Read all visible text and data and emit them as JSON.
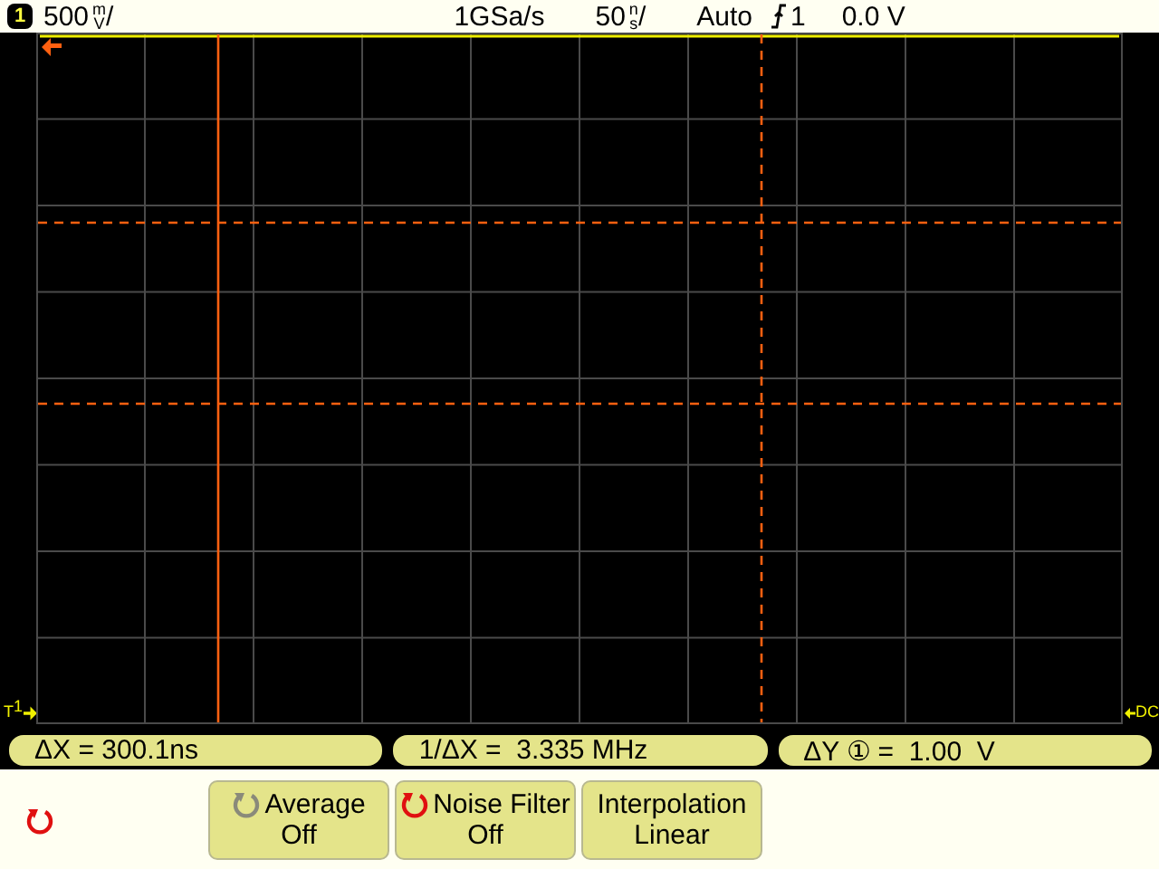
{
  "status_bar": {
    "channel": "1",
    "scale_value": "500",
    "scale_unit_top": "m",
    "scale_unit_bottom": "V",
    "scale_suffix": "/",
    "sample_rate": "1GSa/s",
    "time_value": "50",
    "time_unit_top": "n",
    "time_unit_bottom": "s",
    "time_suffix": "/",
    "trigger_mode": "Auto",
    "trigger_source": "1",
    "trigger_level": "0.0 V"
  },
  "markers": {
    "trigger_label": "T",
    "trigger_channel": "1",
    "coupling": "DC"
  },
  "measurements": [
    {
      "text": "ΔX = 300.1ns"
    },
    {
      "text": "1/ΔX =  3.335 MHz"
    },
    {
      "text": "ΔY ① =  1.00  V"
    }
  ],
  "softkeys": [
    {
      "kind": "knob",
      "knob_active": true
    },
    {
      "kind": "button",
      "label": "Average",
      "value": "Off",
      "knob_active": false
    },
    {
      "kind": "button",
      "label": "Noise Filter",
      "value": "Off",
      "knob_active": true
    },
    {
      "kind": "button",
      "label": "Interpolation",
      "value": "Linear"
    }
  ]
}
